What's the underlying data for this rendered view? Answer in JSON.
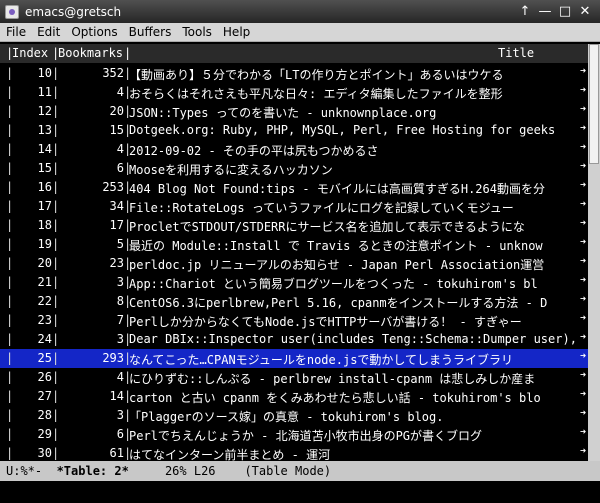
{
  "window": {
    "title": "emacs@gretsch"
  },
  "menu": [
    "File",
    "Edit",
    "Options",
    "Buffers",
    "Tools",
    "Help"
  ],
  "header": {
    "index": "Index",
    "bookmarks": "Bookmarks",
    "title": "Title"
  },
  "rows": [
    {
      "index": "10",
      "bookmarks": "352",
      "title": "【動画あり】５分でわかる「LTの作り方とポイント」あるいはウケる"
    },
    {
      "index": "11",
      "bookmarks": "4",
      "title": "おそらくはそれさえも平凡な日々: エディタ編集したファイルを整形"
    },
    {
      "index": "12",
      "bookmarks": "20",
      "title": "JSON::Types ってのを書いた - unknownplace.org"
    },
    {
      "index": "13",
      "bookmarks": "15",
      "title": "Dotgeek.org: Ruby, PHP, MySQL, Perl, Free Hosting for geeks"
    },
    {
      "index": "14",
      "bookmarks": "4",
      "title": "2012-09-02 - その手の平は尻もつかめるさ"
    },
    {
      "index": "15",
      "bookmarks": "6",
      "title": "Mooseを利用するに変えるハッカソン"
    },
    {
      "index": "16",
      "bookmarks": "253",
      "title": "404 Blog Not Found:tips - モバイルには高画質すぎるH.264動画を分"
    },
    {
      "index": "17",
      "bookmarks": "34",
      "title": "File::RotateLogs っていうファイルにログを記録していくモジュー"
    },
    {
      "index": "18",
      "bookmarks": "17",
      "title": "ProcletでSTDOUT/STDERRにサービス名を追加して表示できるようにな"
    },
    {
      "index": "19",
      "bookmarks": "5",
      "title": "最近の Module::Install で Travis るときの注意ポイント - unknow"
    },
    {
      "index": "20",
      "bookmarks": "23",
      "title": "perldoc.jp リニューアルのお知らせ - Japan Perl Association運営"
    },
    {
      "index": "21",
      "bookmarks": "3",
      "title": "App::Chariot という簡易ブログツールをつくった - tokuhirom's bl"
    },
    {
      "index": "22",
      "bookmarks": "8",
      "title": "CentOS6.3にperlbrew,Perl 5.16, cpanmをインストールする方法 - D"
    },
    {
      "index": "23",
      "bookmarks": "7",
      "title": "Perlしか分からなくてもNode.jsでHTTPサーバが書ける！ - すぎゃー"
    },
    {
      "index": "24",
      "bookmarks": "3",
      "title": "Dear DBIx::Inspector user(includes Teng::Schema::Dumper user),"
    },
    {
      "index": "25",
      "bookmarks": "293",
      "title": "なんてこった…CPANモジュールをnode.jsで動かしてしまうライブラリ",
      "selected": true
    },
    {
      "index": "26",
      "bookmarks": "4",
      "title": "にひりずむ::しんぷる - perlbrew install-cpanm は悲しみしか産ま"
    },
    {
      "index": "27",
      "bookmarks": "14",
      "title": "carton と古い cpanm をくみあわせたら悲しい話 - tokuhirom's blo"
    },
    {
      "index": "28",
      "bookmarks": "3",
      "title": "「Plaggerのソース嫁」の真意 - tokuhirom's blog."
    },
    {
      "index": "29",
      "bookmarks": "6",
      "title": "Perlでちえんじょうか - 北海道苫小牧市出身のPGが書くブログ"
    },
    {
      "index": "30",
      "bookmarks": "61",
      "title": "はてなインターン前半まとめ - 運河"
    }
  ],
  "modeline": {
    "status": "U:%*-",
    "buffer": "*Table: 2*",
    "position": "26% L26",
    "mode": "(Table Mode)"
  }
}
